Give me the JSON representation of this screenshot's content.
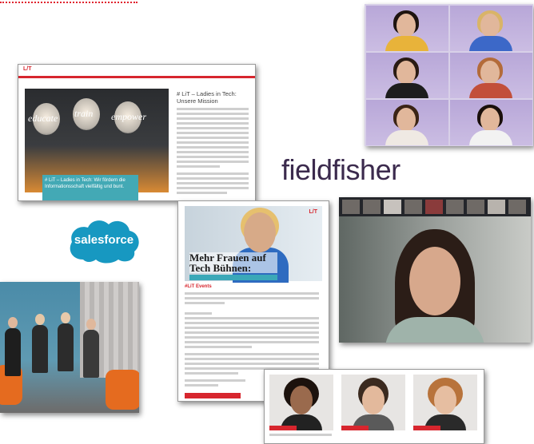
{
  "logos": {
    "fieldfisher": "fieldfisher",
    "salesforce": "salesforce"
  },
  "article1": {
    "brand": "L/T",
    "heading": "# LiT – Ladies in Tech: Unsere Mission",
    "overlay": "# LiT – Ladies in Tech: Wir fördern die Informationsschaft vielfältig und bunt."
  },
  "article2": {
    "brand": "L/T",
    "title": "Mehr Frauen auf Tech Bühnen:",
    "section": "#LiT Events"
  },
  "colors": {
    "brand_red": "#d7262e",
    "teal": "#43a9b5",
    "salesforce_blue": "#1798c1"
  }
}
